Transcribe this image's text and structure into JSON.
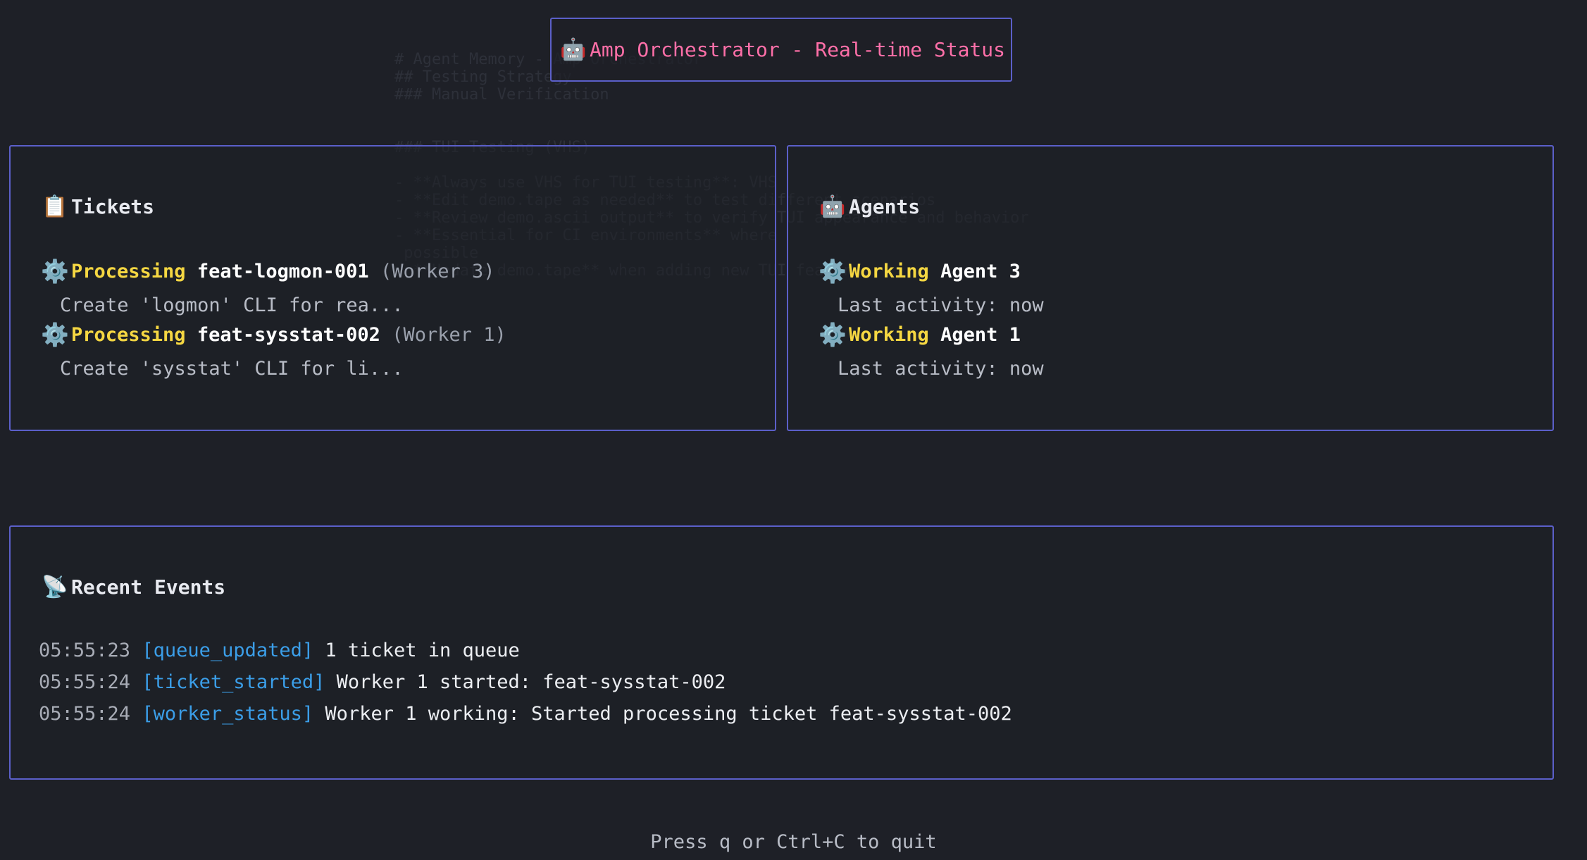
{
  "title": {
    "icon": "robot-icon",
    "icon_glyph": "🤖",
    "text": "Amp Orchestrator - Real-time Status"
  },
  "tickets": {
    "header_icon": "clipboard-icon",
    "header_glyph": "📋",
    "header": "Tickets",
    "items": [
      {
        "icon": "gear-icon",
        "glyph": "⚙️",
        "status": "Processing",
        "id": "feat-logmon-001",
        "worker": "(Worker 3)",
        "desc": "Create 'logmon' CLI for rea..."
      },
      {
        "icon": "gear-icon",
        "glyph": "⚙️",
        "status": "Processing",
        "id": "feat-sysstat-002",
        "worker": "(Worker 1)",
        "desc": "Create 'sysstat' CLI for li..."
      }
    ]
  },
  "agents": {
    "header_icon": "robot-icon",
    "header_glyph": "🤖",
    "header": "Agents",
    "items": [
      {
        "icon": "gear-icon",
        "glyph": "⚙️",
        "status": "Working",
        "name": "Agent 3",
        "activity": "Last activity: now"
      },
      {
        "icon": "gear-icon",
        "glyph": "⚙️",
        "status": "Working",
        "name": "Agent 1",
        "activity": "Last activity: now"
      }
    ]
  },
  "events": {
    "header_icon": "satellite-antenna-icon",
    "header_glyph": "📡",
    "header": "Recent Events",
    "items": [
      {
        "time": "05:55:23",
        "type": "[queue_updated]",
        "message": "1 ticket in queue"
      },
      {
        "time": "05:55:24",
        "type": "[ticket_started]",
        "message": "Worker 1 started: feat-sysstat-002"
      },
      {
        "time": "05:55:24",
        "type": "[worker_status]",
        "message": "Worker 1 working: Started processing ticket feat-sysstat-002"
      }
    ]
  },
  "footer": "Press q or Ctrl+C to quit",
  "colors": {
    "border": "#5b5fc9",
    "title": "#ff6fa8",
    "status": "#f5d742",
    "event_type": "#3b9ee8"
  }
}
